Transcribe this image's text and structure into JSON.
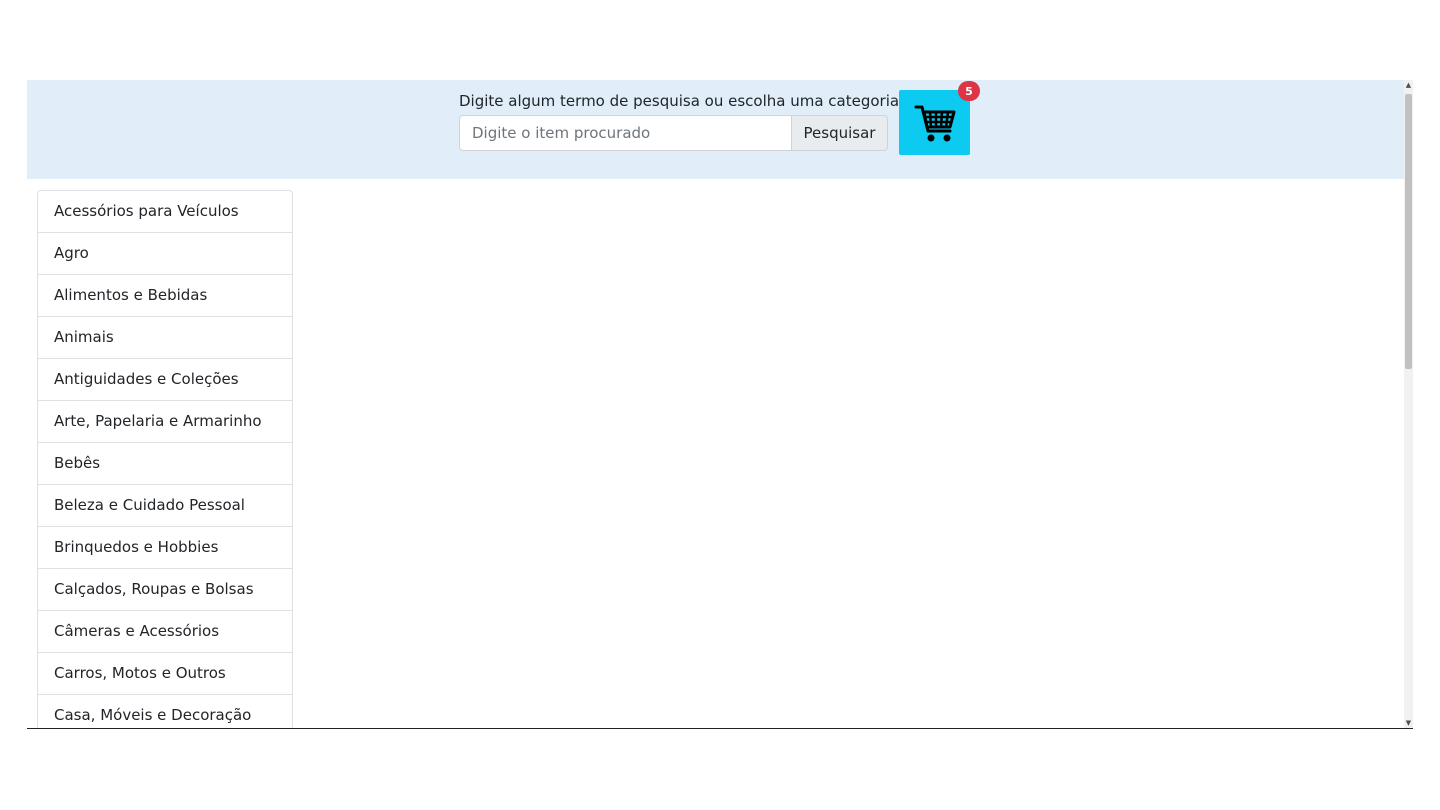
{
  "search": {
    "label": "Digite algum termo de pesquisa ou escolha uma categoria.",
    "placeholder": "Digite o item procurado",
    "button_label": "Pesquisar"
  },
  "cart": {
    "icon": "shopping-cart-icon",
    "badge_count": "5",
    "button_color": "#0dcaf0",
    "badge_color": "#dc3545"
  },
  "header": {
    "background": "#e1eef9"
  },
  "categories": [
    "Acessórios para Veículos",
    "Agro",
    "Alimentos e Bebidas",
    "Animais",
    "Antiguidades e Coleções",
    "Arte, Papelaria e Armarinho",
    "Bebês",
    "Beleza e Cuidado Pessoal",
    "Brinquedos e Hobbies",
    "Calçados, Roupas e Bolsas",
    "Câmeras e Acessórios",
    "Carros, Motos e Outros",
    "Casa, Móveis e Decoração"
  ]
}
